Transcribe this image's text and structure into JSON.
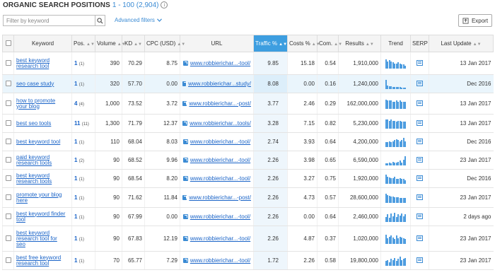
{
  "header": {
    "title": "ORGANIC SEARCH POSITIONS",
    "range": "1 - 100 (2,904)",
    "info_glyph": "i"
  },
  "filter": {
    "placeholder": "Filter by keyword",
    "advanced_label": "Advanced filters"
  },
  "export_label": "Export",
  "columns": [
    "Keyword",
    "Pos.",
    "Volume",
    "KD",
    "CPC (USD)",
    "URL",
    "Traffic %",
    "Costs %",
    "Com.",
    "Results",
    "Trend",
    "SERP",
    "Last Update"
  ],
  "rows": [
    {
      "keyword": [
        "best keyword",
        "research tool"
      ],
      "pos": "1",
      "pos_prev": "(1)",
      "volume": "390",
      "kd": "70.29",
      "cpc": "8.75",
      "url": "www.robbierichar...-tool/",
      "traffic": "9.85",
      "costs": "15.18",
      "com": "0.54",
      "results": "1,910,000",
      "trend": [
        9,
        7,
        8,
        7,
        6,
        5,
        5,
        6,
        5,
        4,
        4,
        3
      ],
      "last_update": "13 Jan 2017",
      "highlight": false
    },
    {
      "keyword": [
        "seo case study"
      ],
      "pos": "1",
      "pos_prev": "(1)",
      "volume": "320",
      "kd": "57.70",
      "cpc": "0.00",
      "url": "www.robbierichar...study/",
      "traffic": "8.08",
      "costs": "0.00",
      "com": "0.16",
      "results": "1,240,000",
      "trend": [
        12,
        5,
        4,
        4,
        3,
        3,
        3,
        3,
        3,
        2,
        2,
        2
      ],
      "last_update": "Dec 2016",
      "highlight": true
    },
    {
      "keyword": [
        "how to promote",
        "your blog"
      ],
      "pos": "4",
      "pos_prev": "(4)",
      "volume": "1,000",
      "kd": "73.52",
      "cpc": "3.72",
      "url": "www.robbierichar...-post/",
      "traffic": "3.77",
      "costs": "2.46",
      "com": "0.29",
      "results": "162,000,000",
      "trend": [
        9,
        8,
        8,
        8,
        7,
        7,
        8,
        7,
        8,
        7,
        7,
        7
      ],
      "last_update": "13 Jan 2017",
      "highlight": false
    },
    {
      "keyword": [
        "best seo tools"
      ],
      "pos": "11",
      "pos_prev": "(11)",
      "volume": "1,300",
      "kd": "71.79",
      "cpc": "12.37",
      "url": "www.robbierichar...tools/",
      "traffic": "3.28",
      "costs": "7.15",
      "com": "0.82",
      "results": "5,230,000",
      "trend": [
        8,
        8,
        7,
        8,
        7,
        7,
        6,
        7,
        7,
        6,
        6,
        6
      ],
      "last_update": "13 Jan 2017",
      "highlight": false
    },
    {
      "keyword": [
        "best keyword tool"
      ],
      "pos": "1",
      "pos_prev": "(1)",
      "volume": "110",
      "kd": "68.04",
      "cpc": "8.03",
      "url": "www.robbierichar...-tool/",
      "traffic": "2.74",
      "costs": "3.93",
      "com": "0.64",
      "results": "4,200,000",
      "trend": [
        4,
        4,
        5,
        4,
        5,
        6,
        7,
        6,
        5,
        6,
        8,
        5
      ],
      "last_update": "Dec 2016",
      "highlight": false
    },
    {
      "keyword": [
        "paid keyword",
        "research tools"
      ],
      "pos": "1",
      "pos_prev": "(2)",
      "volume": "90",
      "kd": "68.52",
      "cpc": "9.96",
      "url": "www.robbierichar...-tool/",
      "traffic": "2.26",
      "costs": "3.98",
      "com": "0.65",
      "results": "6,590,000",
      "trend": [
        3,
        3,
        4,
        3,
        5,
        4,
        4,
        5,
        6,
        4,
        7,
        12
      ],
      "last_update": "23 Jan 2017",
      "highlight": false
    },
    {
      "keyword": [
        "best keyword",
        "research tools"
      ],
      "pos": "1",
      "pos_prev": "(1)",
      "volume": "90",
      "kd": "68.54",
      "cpc": "8.20",
      "url": "www.robbierichar...-tool/",
      "traffic": "2.26",
      "costs": "3.27",
      "com": "0.75",
      "results": "1,920,000",
      "trend": [
        10,
        8,
        7,
        6,
        6,
        8,
        5,
        5,
        6,
        5,
        5,
        4
      ],
      "last_update": "Dec 2016",
      "highlight": false
    },
    {
      "keyword": [
        "promote your blog",
        "here"
      ],
      "pos": "1",
      "pos_prev": "(1)",
      "volume": "90",
      "kd": "71.62",
      "cpc": "11.84",
      "url": "www.robbierichar...-post/",
      "traffic": "2.26",
      "costs": "4.73",
      "com": "0.57",
      "results": "28,600,000",
      "trend": [
        12,
        10,
        9,
        8,
        8,
        7,
        7,
        7,
        6,
        6,
        6,
        6
      ],
      "last_update": "23 Jan 2017",
      "highlight": false
    },
    {
      "keyword": [
        "best keyword finder",
        "tool"
      ],
      "pos": "1",
      "pos_prev": "(1)",
      "volume": "90",
      "kd": "67.99",
      "cpc": "0.00",
      "url": "www.robbierichar...-tool/",
      "traffic": "2.26",
      "costs": "0.00",
      "com": "0.64",
      "results": "2,460,000",
      "trend": [
        6,
        9,
        5,
        10,
        7,
        11,
        6,
        9,
        8,
        10,
        7,
        9
      ],
      "last_update": "2 days ago",
      "highlight": false
    },
    {
      "keyword": [
        "best keyword",
        "research tool for",
        "seo"
      ],
      "pos": "1",
      "pos_prev": "(1)",
      "volume": "90",
      "kd": "67.83",
      "cpc": "12.19",
      "url": "www.robbierichar...-tool/",
      "traffic": "2.26",
      "costs": "4.87",
      "com": "0.37",
      "results": "1,020,000",
      "trend": [
        10,
        6,
        8,
        9,
        7,
        5,
        9,
        6,
        8,
        7,
        6,
        5
      ],
      "last_update": "23 Jan 2017",
      "highlight": false
    },
    {
      "keyword": [
        "best free keyword",
        "research tool"
      ],
      "pos": "1",
      "pos_prev": "(1)",
      "volume": "70",
      "kd": "65.77",
      "cpc": "7.29",
      "url": "www.robbierichar...-tool/",
      "traffic": "1.72",
      "costs": "2.26",
      "com": "0.58",
      "results": "19,800,000",
      "trend": [
        4,
        5,
        3,
        6,
        5,
        7,
        4,
        6,
        8,
        5,
        6,
        7
      ],
      "last_update": "23 Jan 2017",
      "highlight": false
    }
  ]
}
